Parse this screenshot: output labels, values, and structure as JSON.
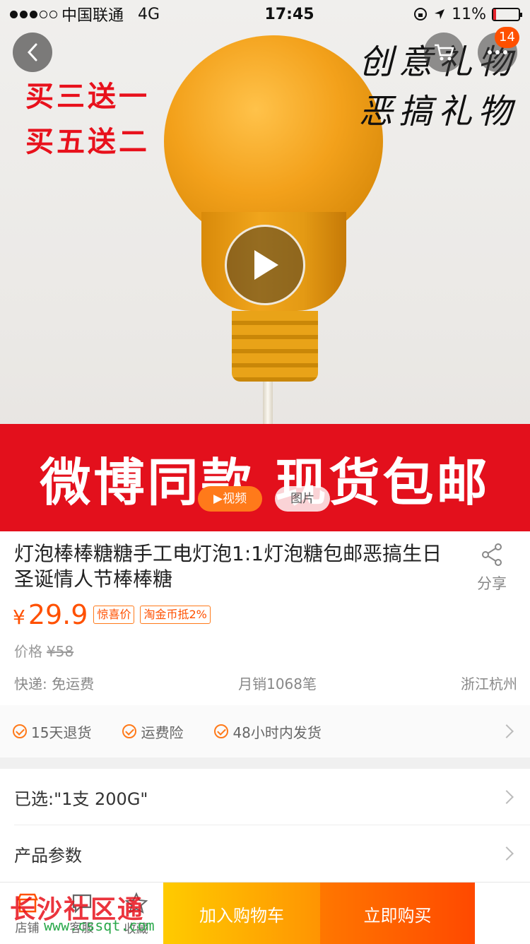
{
  "status_bar": {
    "carrier": "中国联通",
    "network": "4G",
    "time": "17:45",
    "battery": "11%",
    "battery_level": 0.11
  },
  "nav": {
    "cart_badge": "14"
  },
  "hero": {
    "promo_line1": "买三送一",
    "promo_line2": "买五送二",
    "calli_line1": "创意礼物",
    "calli_line2": "恶搞礼物",
    "banner": "微博同款 现货包邮",
    "media_tabs": [
      "视频",
      "图片"
    ],
    "active_media_tab": "视频"
  },
  "product": {
    "title": "灯泡棒棒糖糖手工电灯泡1:1灯泡糖包邮恶搞生日圣诞情人节棒棒糖",
    "share_label": "分享",
    "currency": "¥",
    "price": "29.9",
    "tags": [
      "惊喜价",
      "淘金币抵2%"
    ],
    "orig_price_label": "价格",
    "orig_price": "¥58",
    "shipping": "快递: 免运费",
    "monthly_sales": "月销1068笔",
    "location": "浙江杭州"
  },
  "guarantees": [
    "15天退货",
    "运费险",
    "48小时内发货"
  ],
  "selected": "已选:\"1支 200G\"",
  "params_label": "产品参数",
  "bottom_bar": {
    "shop_label": "店铺",
    "service_label": "客服",
    "favorite_label": "收藏",
    "add_cart_label": "加入购物车",
    "buy_now_label": "立即购买"
  },
  "watermark": {
    "text": "长沙社区通",
    "url": "www.cssqt.com"
  },
  "colors": {
    "accent": "#ff5000",
    "banner_red": "#e3101c",
    "cart_button": "#ff9402",
    "buy_button": "#ff4900"
  }
}
